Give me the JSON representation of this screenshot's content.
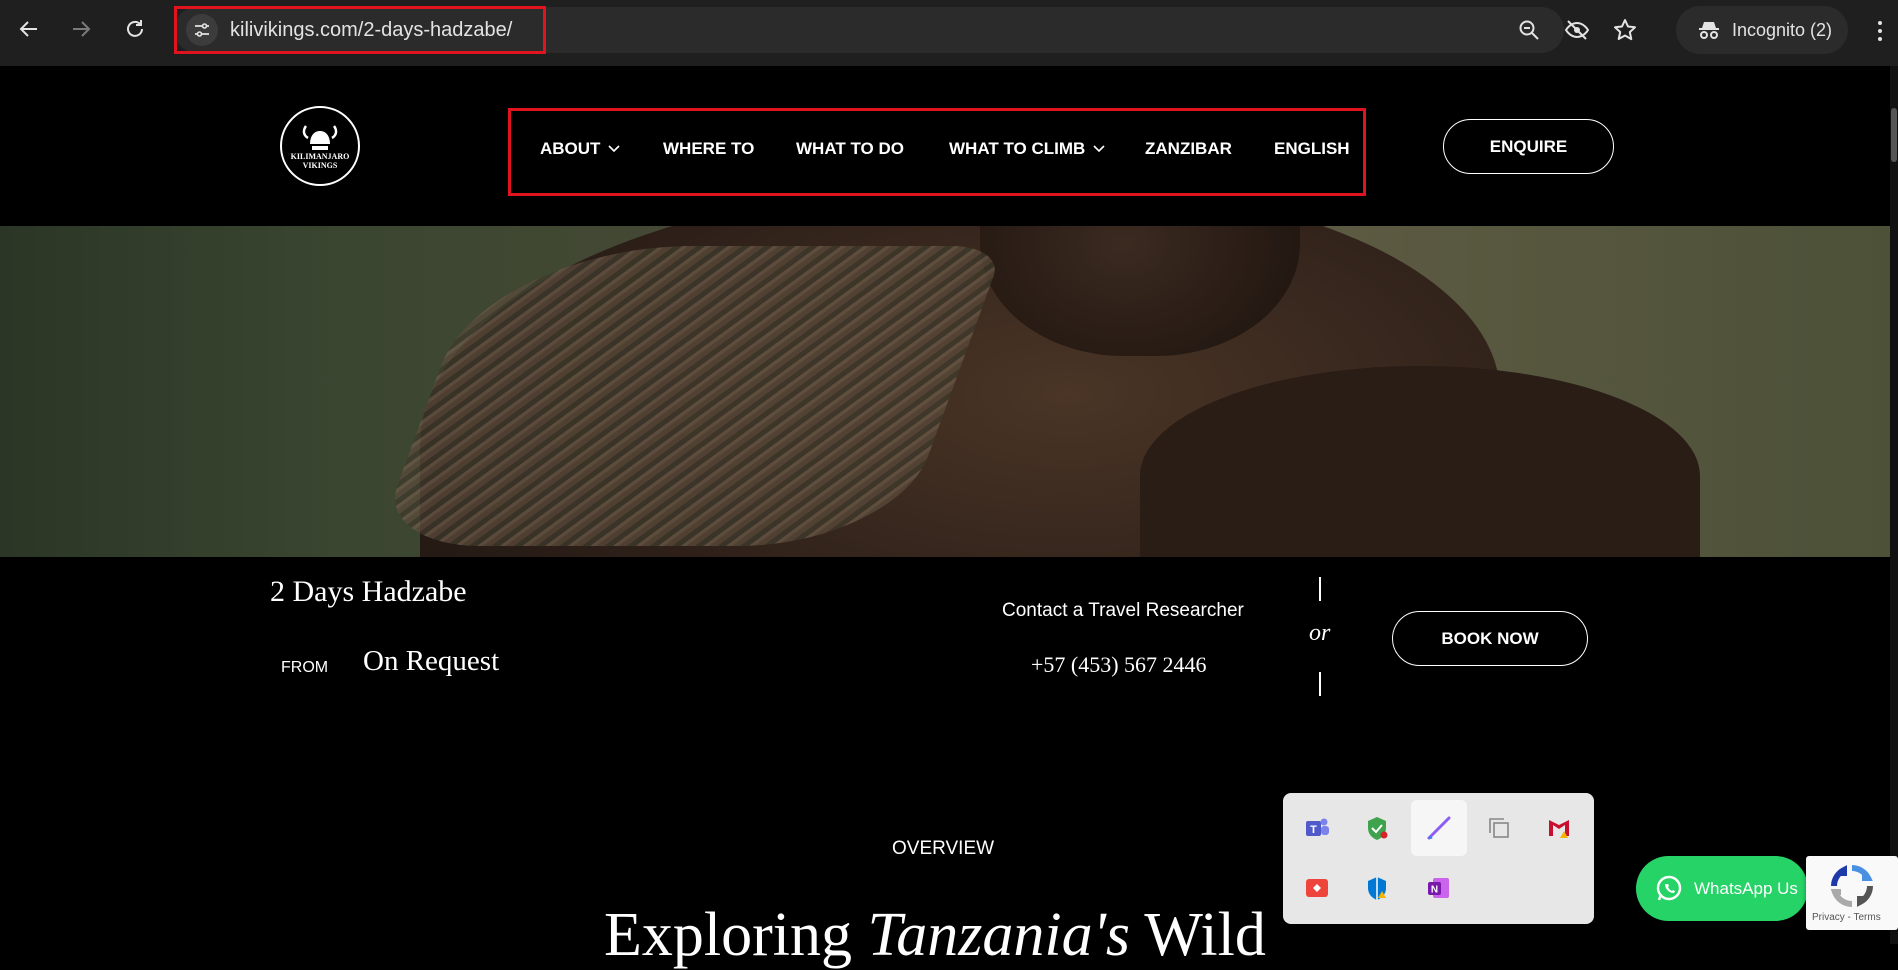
{
  "browser": {
    "url": "kilivikings.com/2-days-hadzabe/",
    "incognito_label": "Incognito (2)"
  },
  "header": {
    "logo_text_top": "KILIMANJARO",
    "logo_text_bottom": "VIKINGS",
    "nav": [
      {
        "label": "ABOUT"
      },
      {
        "label": "WHERE TO"
      },
      {
        "label": "WHAT TO DO"
      },
      {
        "label": "WHAT TO CLIMB"
      },
      {
        "label": "ZANZIBAR"
      },
      {
        "label": "ENGLISH"
      }
    ],
    "enquire_label": "ENQUIRE"
  },
  "trip": {
    "title": "2 Days Hadzabe",
    "from_label": "FROM",
    "price": "On Request",
    "contact_label": "Contact a Travel Researcher",
    "phone": "+57 (453) 567 2446",
    "or_label": "or",
    "book_label": "BOOK NOW"
  },
  "content": {
    "section_label": "OVERVIEW",
    "heading_pre": "Exploring ",
    "heading_em": "Tanzania's",
    "heading_post": " Wild"
  },
  "widgets": {
    "whatsapp_label": "WhatsApp Us",
    "recaptcha_text": "Privacy - Terms"
  },
  "colors": {
    "highlight": "#e0141e",
    "whatsapp": "#25d366"
  }
}
